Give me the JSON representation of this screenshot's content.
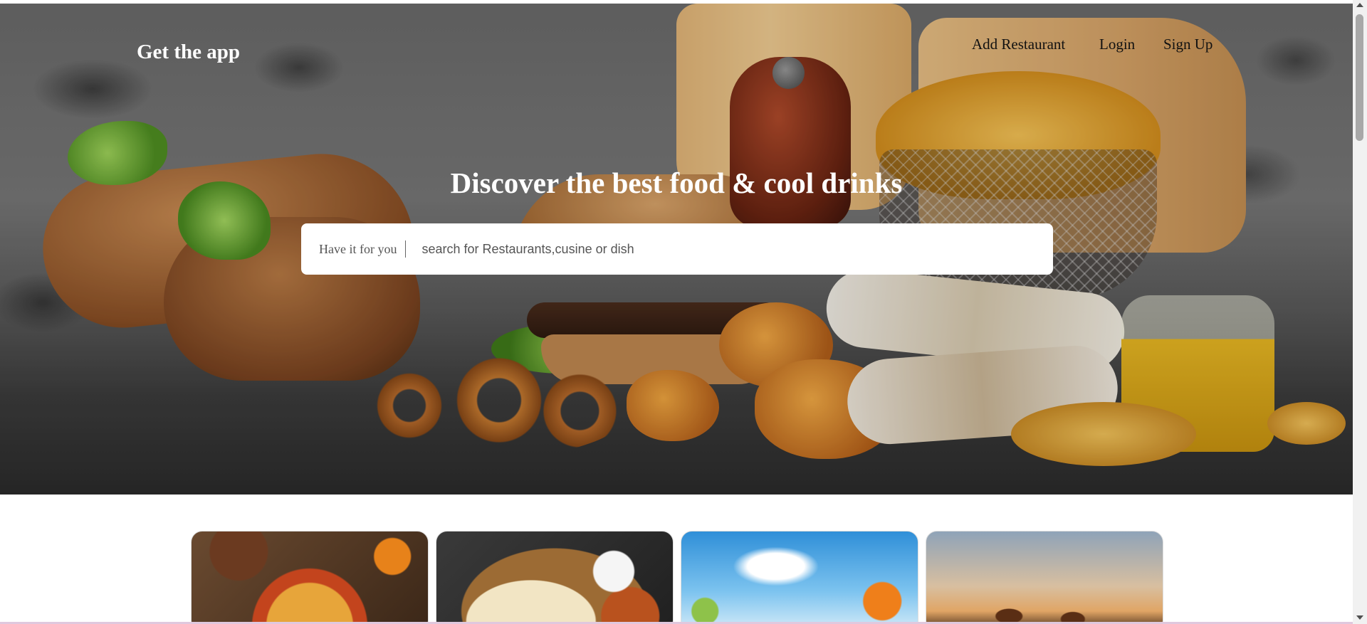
{
  "header": {
    "brand": "Get the app",
    "nav": {
      "add_restaurant": "Add Restaurant",
      "login": "Login",
      "signup": "Sign Up"
    }
  },
  "hero": {
    "headline": "Discover the best food & cool drinks"
  },
  "search": {
    "location_label": "Have it for you",
    "placeholder": "search for Restaurants,cusine or dish"
  },
  "cards": [
    {
      "image": "pizza"
    },
    {
      "image": "naan-platter"
    },
    {
      "image": "summer-drinks"
    },
    {
      "image": "beer-sunset"
    }
  ]
}
